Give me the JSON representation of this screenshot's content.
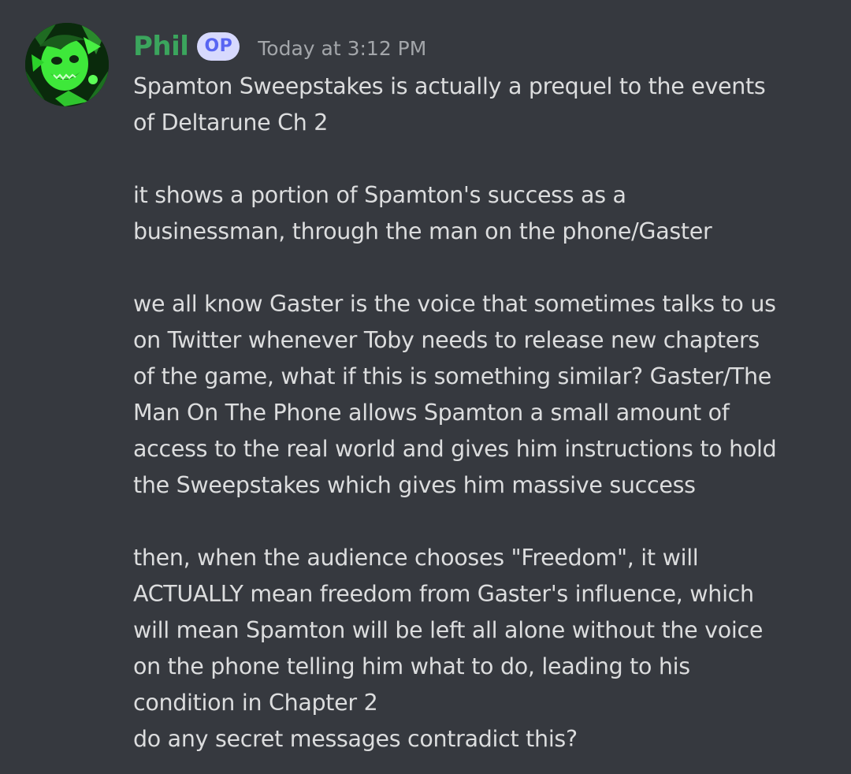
{
  "message": {
    "author": "Phil",
    "badge": "OP",
    "timestamp": "Today at 3:12 PM",
    "username_color": "#3ba55d",
    "avatar": "green-character-avatar",
    "lines": [
      "Spamton Sweepstakes is actually a prequel to the events",
      "of Deltarune Ch 2",
      "",
      "it shows a portion of Spamton's success as a",
      "businessman, through the man on the phone/Gaster",
      "",
      "we all know Gaster is the voice that sometimes talks to us",
      "on Twitter whenever Toby needs to release new chapters",
      "of the game, what if this is something similar? Gaster/The",
      "Man On The Phone allows Spamton a small amount of",
      "access to the real world and gives him instructions to hold",
      "the Sweepstakes which gives him massive success",
      "",
      "then, when the audience chooses \"Freedom\", it will",
      "ACTUALLY mean freedom from Gaster's influence, which",
      "will mean Spamton will be left all alone without the voice",
      "on the phone telling him what to do, leading to his",
      "condition in Chapter 2"
    ],
    "followup": "do any secret messages contradict this?"
  }
}
